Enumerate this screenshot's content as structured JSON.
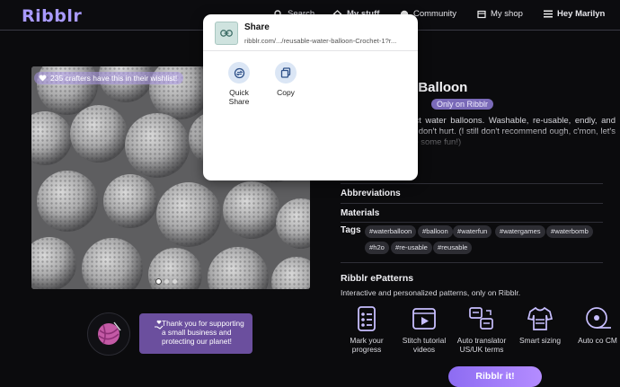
{
  "header": {
    "logo": "Ribblr",
    "nav": {
      "search": "Search",
      "my_stuff": "My stuff",
      "community": "Community",
      "my_shop": "My shop",
      "greeting": "Hey Marilyn"
    }
  },
  "product": {
    "wishlist_badge": "235 crafters have this in their wishlist!",
    "title": "er Balloon",
    "only_pill": "Only on Ribblr",
    "description": "erfect water balloons. Washable, re-usable, endly, and they don't hurt. (I still don't recommend ough, c'mon, let's have some fun!)",
    "carousel": {
      "slides": 3,
      "active": 1
    },
    "sections": [
      "Abbreviations",
      "Materials"
    ],
    "tags_label": "Tags",
    "tags": [
      "#waterballoon",
      "#balloon",
      "#waterfun",
      "#watergames",
      "#waterbomb",
      "#h2o",
      "#re-usable",
      "#reusable"
    ]
  },
  "support": {
    "message": "Thank you for supporting a small business and protecting our planet!"
  },
  "epatterns": {
    "title": "Ribblr ePatterns",
    "subtitle": "Interactive and personalized patterns, only on Ribblr.",
    "features": [
      {
        "icon": "checklist-icon",
        "label": "Mark your progress"
      },
      {
        "icon": "video-play-icon",
        "label": "Stitch tutorial videos"
      },
      {
        "icon": "translate-icon",
        "label": "Auto translator US/UK terms"
      },
      {
        "icon": "sweater-icon",
        "label": "Smart sizing"
      },
      {
        "icon": "measuring-tape-icon",
        "label": "Auto co CM"
      }
    ],
    "cta": "Ribblr it!"
  },
  "share_sheet": {
    "title": "Share",
    "url": "ribblr.com/.../reusable-water-balloon-Crochet-1?r...",
    "actions": [
      {
        "icon": "quick-share-icon",
        "label": "Quick Share"
      },
      {
        "icon": "copy-icon",
        "label": "Copy"
      }
    ]
  },
  "colors": {
    "background": "#0b0b0d",
    "accent": "#a99aff",
    "support_box": "#6b4f9e",
    "cta_gradient_start": "#8d6cf2",
    "cta_gradient_end": "#b48cff"
  }
}
